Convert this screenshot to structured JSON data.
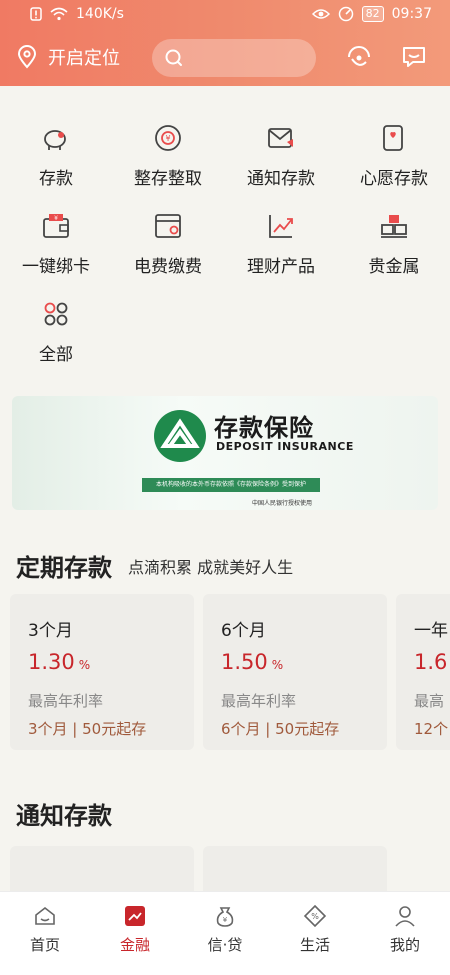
{
  "status": {
    "speed": "140K/s",
    "battery": "82",
    "time": "09:37"
  },
  "header": {
    "location_label": "开启定位",
    "search_placeholder": ""
  },
  "services": [
    {
      "label": "存款",
      "icon": "piggy-bank-icon"
    },
    {
      "label": "整存整取",
      "icon": "yuan-coin-icon"
    },
    {
      "label": "通知存款",
      "icon": "envelope-notify-icon"
    },
    {
      "label": "心愿存款",
      "icon": "wish-phone-icon"
    },
    {
      "label": "一键绑卡",
      "icon": "wallet-card-icon"
    },
    {
      "label": "电费缴费",
      "icon": "bill-icon"
    },
    {
      "label": "理财产品",
      "icon": "trend-chart-icon"
    },
    {
      "label": "贵金属",
      "icon": "gold-bars-icon"
    },
    {
      "label": "全部",
      "icon": "grid-dots-icon"
    }
  ],
  "banner": {
    "title_cn": "存款保险",
    "title_en": "DEPOSIT INSURANCE",
    "strip": "本机构吸收的本外币存款依照《存款保险条例》受到保护",
    "sub": "中国人民银行授权使用"
  },
  "fixed": {
    "title": "定期存款",
    "subtitle": "点滴积累 成就美好人生",
    "cards": [
      {
        "term": "3个月",
        "rate": "1.30",
        "unit": "%",
        "label": "最高年利率",
        "meta": "3个月 | 50元起存"
      },
      {
        "term": "6个月",
        "rate": "1.50",
        "unit": "%",
        "label": "最高年利率",
        "meta": "6个月 | 50元起存"
      },
      {
        "term": "一年",
        "rate": "1.6",
        "unit": "",
        "label": "最高",
        "meta": "12个"
      }
    ]
  },
  "notice": {
    "title": "通知存款"
  },
  "tabs": [
    {
      "label": "首页",
      "icon": "home-icon",
      "active": false
    },
    {
      "label": "金融",
      "icon": "finance-icon",
      "active": true
    },
    {
      "label": "信·贷",
      "icon": "loan-icon",
      "active": false
    },
    {
      "label": "生活",
      "icon": "life-icon",
      "active": false
    },
    {
      "label": "我的",
      "icon": "profile-icon",
      "active": false
    }
  ],
  "colors": {
    "accent": "#c8262b",
    "header_start": "#f07a63",
    "header_end": "#f39a7a",
    "brown": "#a05a3c"
  }
}
